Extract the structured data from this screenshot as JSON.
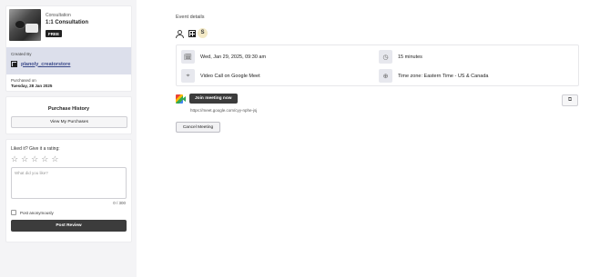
{
  "product": {
    "category": "Consultation",
    "title": "1:1 Consultation",
    "price_badge": "FREE"
  },
  "creator": {
    "label": "Created By",
    "name": "planoly_creatorstore"
  },
  "purchase": {
    "label": "Purchased on",
    "date": "Tuesday, 28 Jan 2025"
  },
  "history": {
    "title": "Purchase History",
    "button": "View My Purchases"
  },
  "review": {
    "prompt": "Liked it? Give it a rating:",
    "stars": 5,
    "textarea_placeholder": "What did you like?",
    "counter": "0 / 300",
    "anonymous_label": "Post anonymously",
    "submit": "Post Review"
  },
  "event": {
    "title": "Event details",
    "attendee_initial": "S",
    "date_time": "Wed, Jan 29, 2025, 09:30 am",
    "duration": "15 minutes",
    "location": "Video Call on Google Meet",
    "timezone": "Time zone: Eastern Time - US & Canada",
    "join_button": "Join meeting now",
    "meet_link": "https://meet.google.com/cyy-nphe-jsj",
    "copy_icon": "⧉",
    "cancel_button": "Cancel Meeting"
  },
  "icons": {
    "calendar": "🗓",
    "clock": "◷",
    "pin": "⌖",
    "globe": "⊕"
  }
}
